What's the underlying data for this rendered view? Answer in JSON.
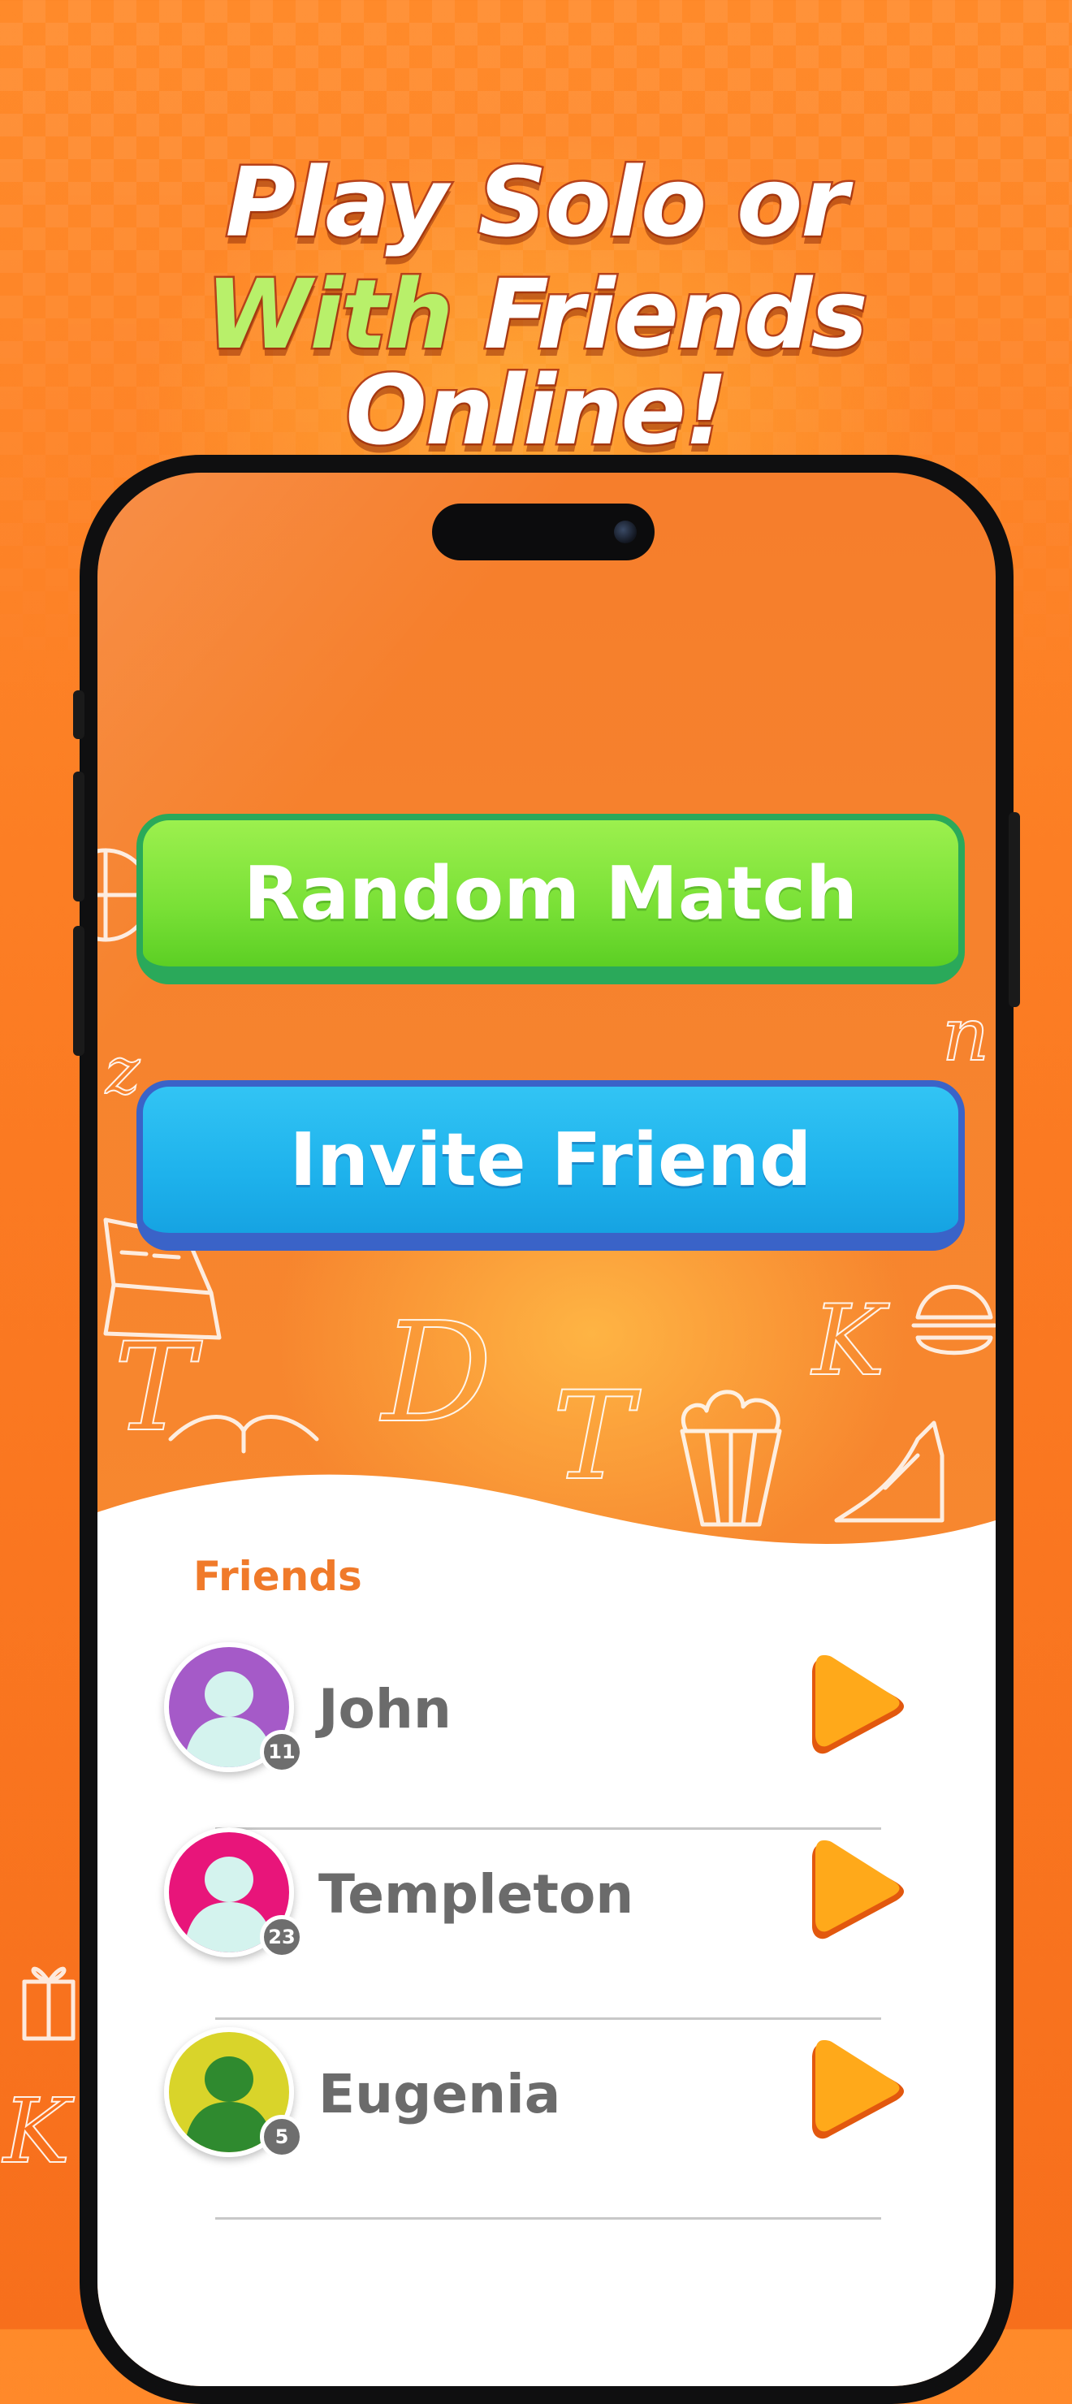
{
  "headline": {
    "line1": [
      "Play ",
      "Solo ",
      "or"
    ],
    "line2": [
      "With ",
      "Friends ",
      "Online!"
    ]
  },
  "buttons": {
    "random_match": "Random Match",
    "invite_friend": "Invite Friend"
  },
  "friends": {
    "title": "Friends",
    "list": [
      {
        "name": "John",
        "level": "11",
        "avatar_color": "#a55ac8"
      },
      {
        "name": "Templeton",
        "level": "23",
        "avatar_color": "#e8157a"
      },
      {
        "name": "Eugenia",
        "level": "5",
        "avatar_color": "#d9d42a"
      }
    ]
  },
  "colors": {
    "background": "#fb7a22",
    "random_button": "#79e036",
    "invite_button": "#1eb2ec",
    "friends_title": "#f07a2a",
    "play_icon": "#ffa91a"
  },
  "doodle_letters": [
    "z",
    "n",
    "T",
    "D",
    "T",
    "K",
    "K"
  ]
}
